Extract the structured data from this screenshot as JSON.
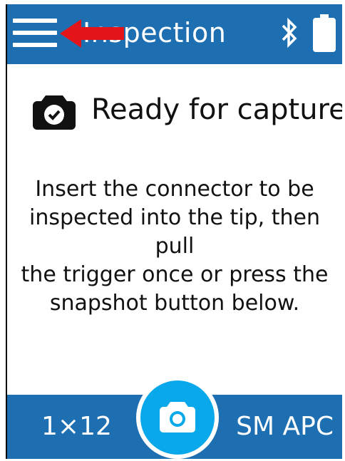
{
  "header": {
    "title": "Inspection"
  },
  "status": {
    "title": "Ready for capture"
  },
  "instructions": {
    "line1": "Insert the connector to be",
    "line2": "inspected into the tip, then pull",
    "line3": "the trigger once or press the",
    "line4": "snapshot button below."
  },
  "footer": {
    "left_label": "1×12",
    "right_label": "SM APC"
  },
  "icons": {
    "menu": "hamburger-menu-icon",
    "annotation": "red-arrow-left",
    "bluetooth": "bluetooth-icon",
    "battery": "battery-full-icon",
    "status": "camera-check-icon",
    "snapshot": "camera-icon"
  },
  "colors": {
    "bar": "#1e6fb2",
    "snapshot_button": "#08a8ea",
    "annotation_arrow": "#e4141b",
    "text": "#111111"
  }
}
